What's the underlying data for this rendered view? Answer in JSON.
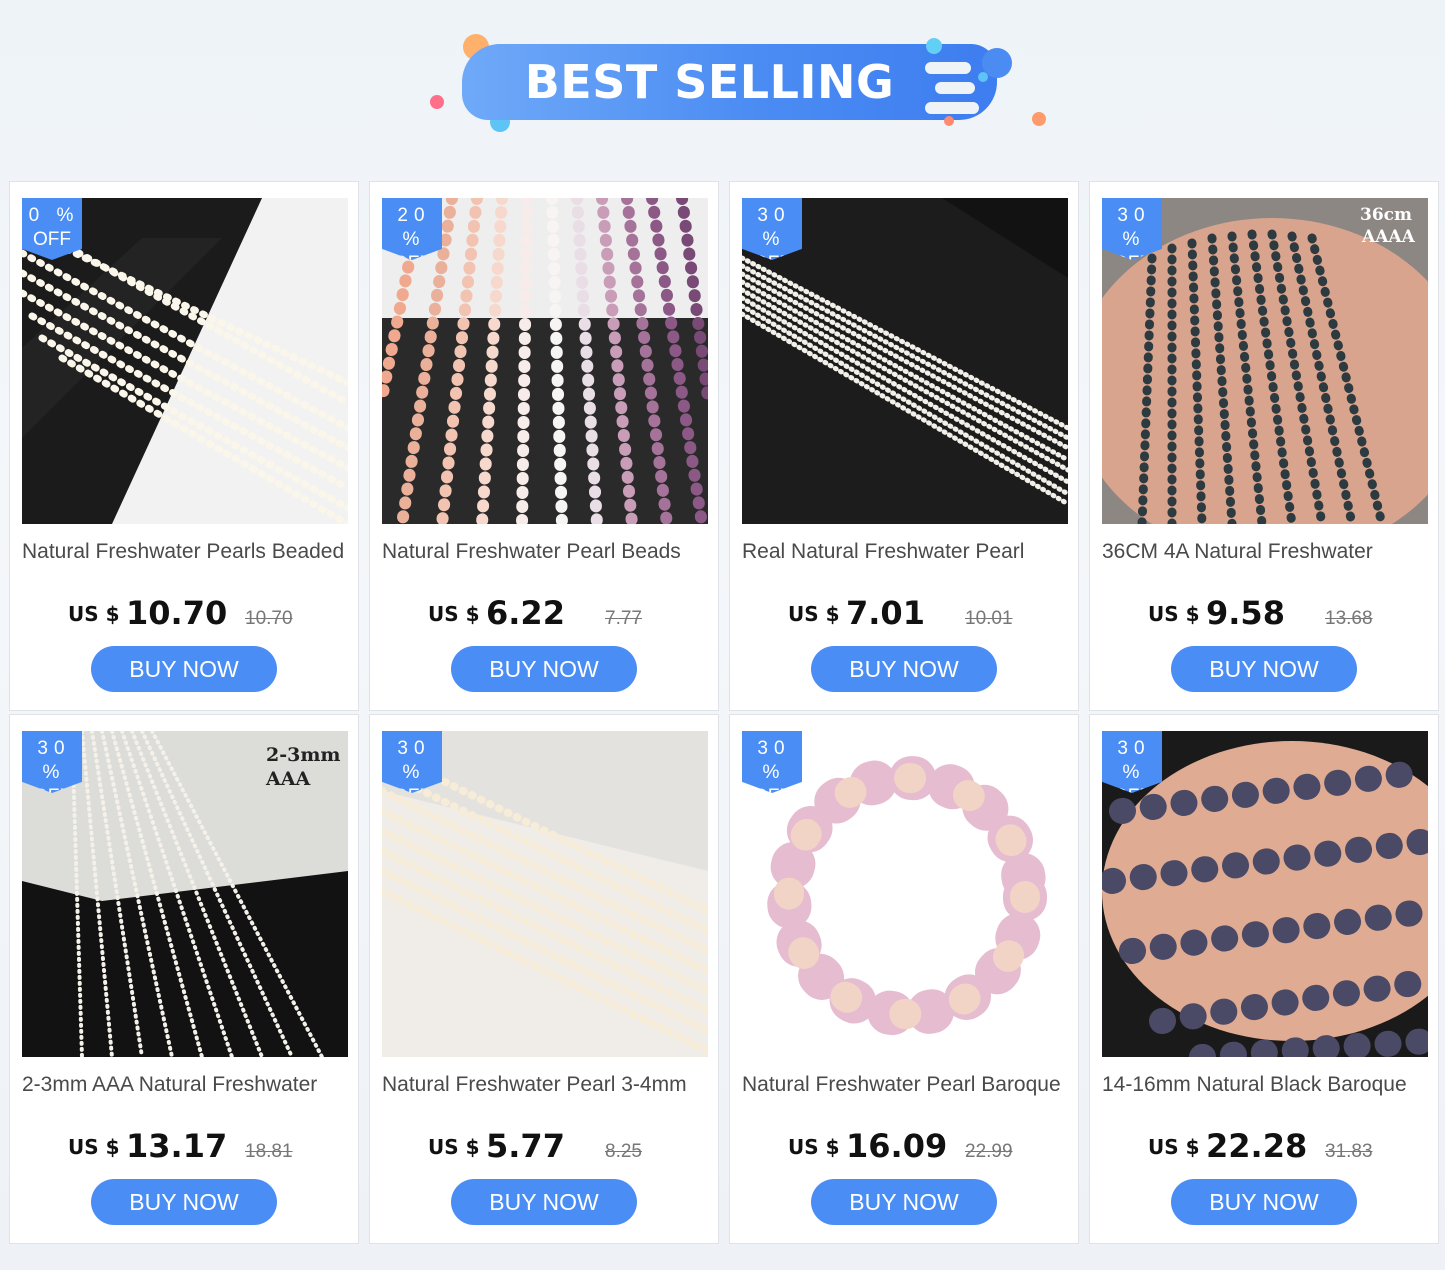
{
  "banner": {
    "title": "BEST SELLING"
  },
  "colors": {
    "accent": "#4a8ef5",
    "badge": "#4a8ef5",
    "button": "#4a8ef5"
  },
  "products": [
    {
      "discount": "0  %",
      "off": "OFF",
      "title": "Natural Freshwater Pearls Beaded",
      "currency": "US $",
      "price": "10.70",
      "old_price": "10.70",
      "button": "BUY NOW",
      "image": "white-rice-pearl-strands"
    },
    {
      "discount": "20  %",
      "off": "OFF",
      "title": "Natural Freshwater Pearl Beads",
      "currency": "US $",
      "price": "6.22",
      "old_price": "7.77",
      "button": "BUY NOW",
      "image": "pink-purple-pearl-strands"
    },
    {
      "discount": "30  %",
      "off": "OFF",
      "title": "Real Natural Freshwater Pearl",
      "currency": "US $",
      "price": "7.01",
      "old_price": "10.01",
      "button": "BUY NOW",
      "image": "small-white-pearl-strands"
    },
    {
      "discount": "30  %",
      "off": "OFF",
      "title": "36CM 4A Natural Freshwater",
      "currency": "US $",
      "price": "9.58",
      "old_price": "13.68",
      "button": "BUY NOW",
      "image": "black-pearl-strands-in-hand",
      "overlay": [
        "36cm",
        "AAAA"
      ]
    },
    {
      "discount": "30  %",
      "off": "OFF",
      "title": "2-3mm AAA Natural Freshwater",
      "currency": "US $",
      "price": "13.17",
      "old_price": "18.81",
      "button": "BUY NOW",
      "image": "tiny-white-pearl-strands",
      "overlay": [
        "2-3mm",
        "AAA"
      ]
    },
    {
      "discount": "30  %",
      "off": "OFF",
      "title": "Natural Freshwater Pearl 3-4mm",
      "currency": "US $",
      "price": "5.77",
      "old_price": "8.25",
      "button": "BUY NOW",
      "image": "cream-pearl-strands"
    },
    {
      "discount": "30  %",
      "off": "OFF",
      "title": "Natural Freshwater Pearl Baroque",
      "currency": "US $",
      "price": "16.09",
      "old_price": "22.99",
      "button": "BUY NOW",
      "image": "pink-baroque-pearl-circle"
    },
    {
      "discount": "30  %",
      "off": "OFF",
      "title": "14-16mm Natural Black Baroque",
      "currency": "US $",
      "price": "22.28",
      "old_price": "31.83",
      "button": "BUY NOW",
      "image": "black-baroque-pearls-in-hand"
    }
  ]
}
